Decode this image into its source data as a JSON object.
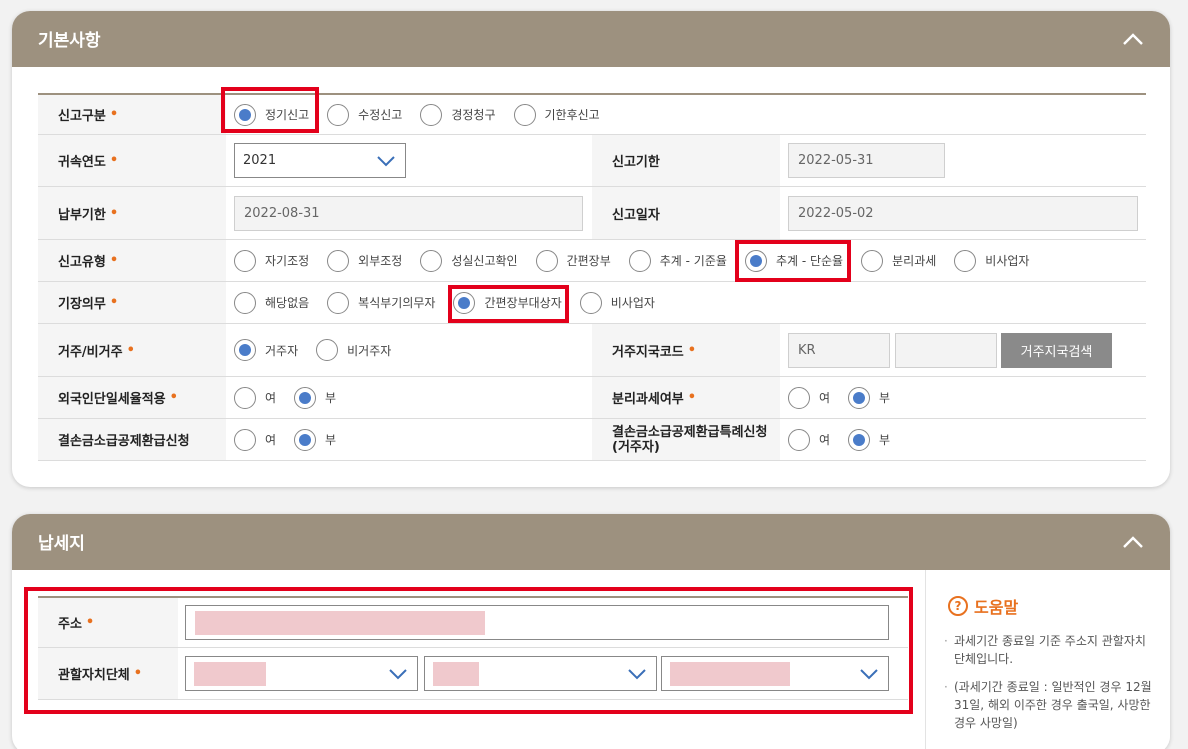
{
  "basic": {
    "title": "기본사항",
    "report_type": {
      "label": "신고구분",
      "options": [
        "정기신고",
        "수정신고",
        "경정청구",
        "기한후신고"
      ],
      "selected": 0
    },
    "attr_year": {
      "label": "귀속연도",
      "value": "2021"
    },
    "report_deadline": {
      "label": "신고기한",
      "value": "2022-05-31"
    },
    "pay_deadline": {
      "label": "납부기한",
      "value": "2022-08-31"
    },
    "report_date": {
      "label": "신고일자",
      "value": "2022-05-02"
    },
    "report_kind": {
      "label": "신고유형",
      "options": [
        "자기조정",
        "외부조정",
        "성실신고확인",
        "간편장부",
        "추계 - 기준율",
        "추계 - 단순율",
        "분리과세",
        "비사업자"
      ],
      "selected": 5
    },
    "bookkeeping": {
      "label": "기장의무",
      "options": [
        "해당없음",
        "복식부기의무자",
        "간편장부대상자",
        "비사업자"
      ],
      "selected": 2
    },
    "residency": {
      "label": "거주/비거주",
      "options": [
        "거주자",
        "비거주자"
      ],
      "selected": 0
    },
    "country_code": {
      "label": "거주지국코드",
      "value": "KR",
      "button": "거주지국검색"
    },
    "foreigner_flat": {
      "label": "외국인단일세율적용",
      "options": [
        "여",
        "부"
      ],
      "selected": 1
    },
    "separate_tax": {
      "label": "분리과세여부",
      "options": [
        "여",
        "부"
      ],
      "selected": 1
    },
    "loss_refund": {
      "label": "결손금소급공제환급신청",
      "options": [
        "여",
        "부"
      ],
      "selected": 1
    },
    "loss_refund_special": {
      "label_line1": "결손금소급공제환급특례신청",
      "label_line2": "(거주자)",
      "options": [
        "여",
        "부"
      ],
      "selected": 1
    }
  },
  "taxplace": {
    "title": "납세지",
    "address": {
      "label": "주소"
    },
    "local_gov": {
      "label": "관할자치단체"
    }
  },
  "help": {
    "title": "도움말",
    "q_icon": "?",
    "line1": "과세기간 종료일 기준 주소지 관할자치단체입니다.",
    "line2": "(과세기간 종료일 : 일반적인 경우 12월31일, 해외 이주한 경우 출국일, 사망한 경우 사망일)"
  },
  "required_mark": "•",
  "colors": {
    "header": "#9d917f",
    "accent": "#e8711f",
    "radio_on": "#4a7cc9",
    "highlight": "#e3001b"
  }
}
